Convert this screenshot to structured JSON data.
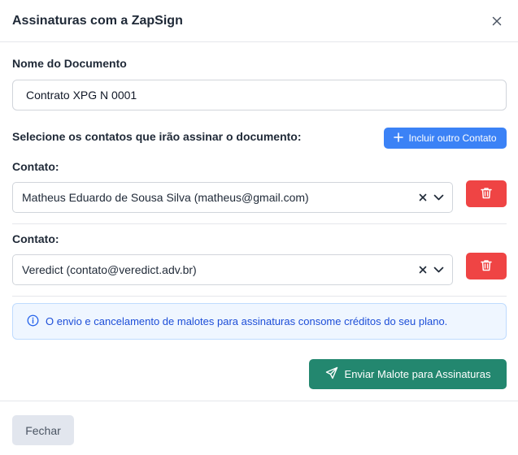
{
  "modal": {
    "title": "Assinaturas com a ZapSign"
  },
  "document": {
    "label": "Nome do Documento",
    "value": "Contrato XPG N 0001"
  },
  "contacts_section": {
    "heading": "Selecione os contatos que irão assinar o documento:",
    "add_button_label": "Incluir outro Contato",
    "items": [
      {
        "label": "Contato:",
        "value": "Matheus Eduardo de Sousa Silva (matheus@gmail.com)"
      },
      {
        "label": "Contato:",
        "value": "Veredict (contato@veredict.adv.br)"
      }
    ]
  },
  "info": {
    "text": "O envio e cancelamento de malotes para assinaturas consome créditos do seu plano.",
    "icon": "info-circle-icon"
  },
  "actions": {
    "send_label": "Enviar Malote para Assinaturas",
    "close_label": "Fechar"
  },
  "colors": {
    "primary_blue": "#3b82f6",
    "danger_red": "#ef4444",
    "send_green": "#23876f",
    "info_bg": "#eff6ff",
    "info_text": "#1d4ed8"
  }
}
